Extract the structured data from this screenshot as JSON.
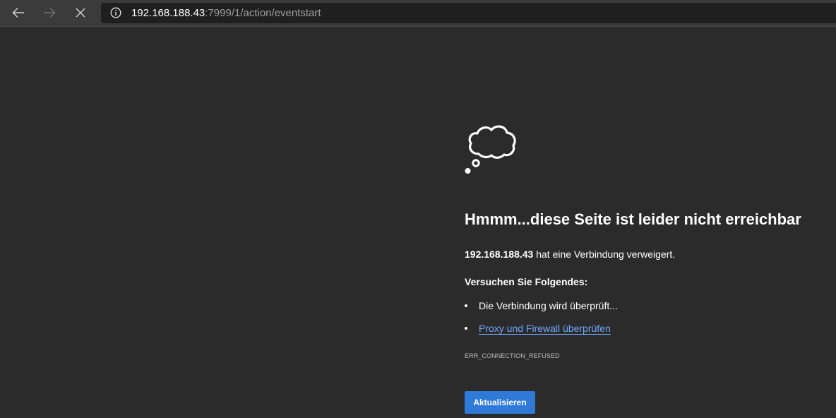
{
  "browser": {
    "back_icon": "back-arrow-icon",
    "forward_icon": "forward-arrow-icon",
    "stop_icon": "close-icon",
    "info_icon": "info-icon",
    "url_host": "192.168.188.43",
    "url_rest": ":7999/1/action/eventstart"
  },
  "error_page": {
    "icon": "thought-cloud-icon",
    "headline": "Hmmm...diese Seite ist leider nicht erreichbar",
    "host": "192.168.188.43",
    "description_suffix": " hat eine Verbindung verweigert.",
    "try_heading": "Versuchen Sie Folgendes:",
    "suggestions": [
      {
        "label": "Die Verbindung wird überprüft...",
        "is_link": false
      },
      {
        "label": "Proxy und Firewall überprüfen",
        "is_link": true
      }
    ],
    "error_code": "ERR_CONNECTION_REFUSED",
    "refresh_label": "Aktualisieren"
  },
  "colors": {
    "page_background": "#2b2b2b",
    "toolbar_background": "#3b3b3b",
    "address_background": "#1f1f1f",
    "link": "#6fa8ff",
    "button": "#2f7ad8"
  }
}
